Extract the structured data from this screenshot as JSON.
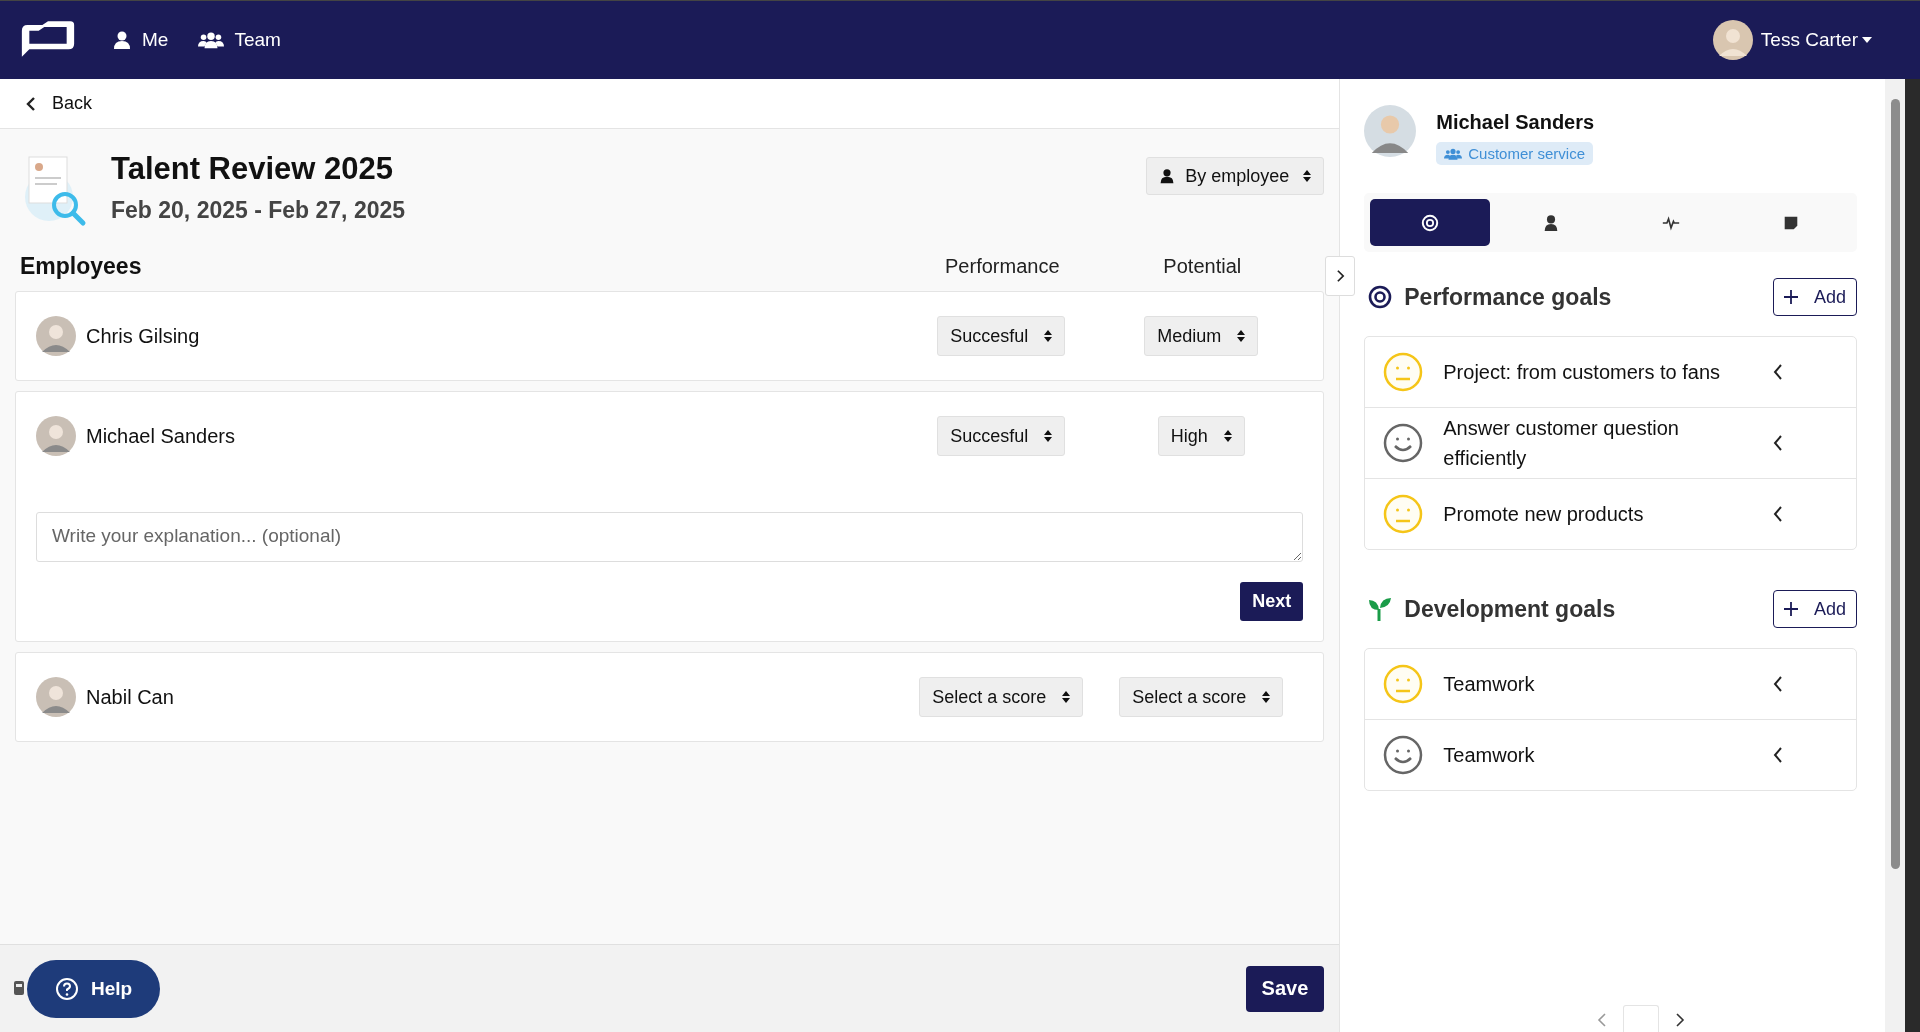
{
  "topbar": {
    "nav": [
      {
        "kind": "person",
        "label": "Me"
      },
      {
        "kind": "team",
        "label": "Team"
      }
    ],
    "user": {
      "name": "Tess Carter"
    }
  },
  "back": {
    "label": "Back"
  },
  "review": {
    "title": "Talent Review 2025",
    "dates": "Feb 20, 2025 - Feb 27, 2025",
    "view_select": "By employee"
  },
  "employees": {
    "heading": "Employees",
    "columns": [
      "Performance",
      "Potential"
    ],
    "rows": [
      {
        "name": "Chris Gilsing",
        "performance": "Succesful",
        "potential": "Medium",
        "expanded": false
      },
      {
        "name": "Michael Sanders",
        "performance": "Succesful",
        "potential": "High",
        "expanded": true,
        "placeholder": "Write your explanation... (optional)",
        "next": "Next"
      },
      {
        "name": "Nabil Can",
        "performance": "Select a score",
        "potential": "Select a score",
        "expanded": false
      }
    ]
  },
  "footer": {
    "help": "Help",
    "save": "Save"
  },
  "profile": {
    "name": "Michael Sanders",
    "team": "Customer service",
    "tabs": [
      {
        "kind": "target",
        "selected": true
      },
      {
        "kind": "person",
        "selected": false
      },
      {
        "kind": "pulse",
        "selected": false
      },
      {
        "kind": "note",
        "selected": false
      }
    ],
    "sections": [
      {
        "kind": "performance",
        "title": "Performance goals",
        "add": "Add",
        "goals": [
          {
            "title": "Project: from customers to fans",
            "kind": "neutral"
          },
          {
            "title": "Answer customer question efficiently",
            "kind": "happy"
          },
          {
            "title": "Promote new products",
            "kind": "neutral"
          }
        ]
      },
      {
        "kind": "development",
        "title": "Development goals",
        "add": "Add",
        "goals": [
          {
            "title": "Teamwork",
            "kind": "neutral"
          },
          {
            "title": "Teamwork",
            "kind": "happy"
          }
        ]
      }
    ]
  }
}
